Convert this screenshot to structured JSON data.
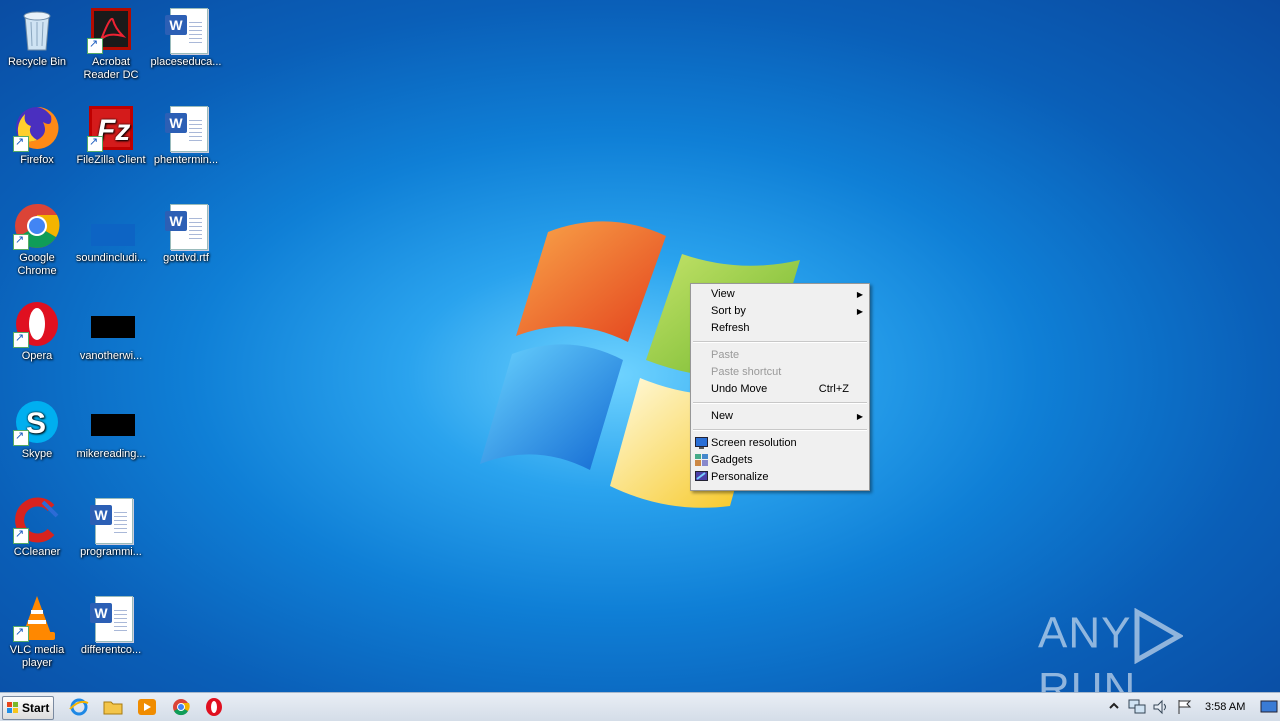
{
  "desktop": {
    "icons": [
      {
        "label": "Recycle Bin",
        "icon": "recycle-bin-icon"
      },
      {
        "label": "Acrobat Reader DC",
        "icon": "acrobat-icon"
      },
      {
        "label": "placeseduca...",
        "icon": "word-document-icon"
      },
      {
        "label": "Firefox",
        "icon": "firefox-icon"
      },
      {
        "label": "FileZilla Client",
        "icon": "filezilla-icon"
      },
      {
        "label": "phentermin...",
        "icon": "word-document-icon"
      },
      {
        "label": "Google Chrome",
        "icon": "chrome-icon"
      },
      {
        "label": "soundincludi...",
        "icon": "blank-file-icon"
      },
      {
        "label": "gotdvd.rtf",
        "icon": "word-document-icon"
      },
      {
        "label": "Opera",
        "icon": "opera-icon"
      },
      {
        "label": "vanotherwi...",
        "icon": "black-file-icon"
      },
      {
        "label": "Skype",
        "icon": "skype-icon"
      },
      {
        "label": "mikereading...",
        "icon": "black-file-icon"
      },
      {
        "label": "CCleaner",
        "icon": "ccleaner-icon"
      },
      {
        "label": "programmi...",
        "icon": "word-document-icon"
      },
      {
        "label": "VLC media player",
        "icon": "vlc-icon"
      },
      {
        "label": "differentco...",
        "icon": "word-document-icon"
      }
    ]
  },
  "context_menu": {
    "view": "View",
    "sort_by": "Sort by",
    "refresh": "Refresh",
    "paste": "Paste",
    "paste_shortcut": "Paste shortcut",
    "undo_move": "Undo Move",
    "undo_shortcut": "Ctrl+Z",
    "new": "New",
    "screen_resolution": "Screen resolution",
    "gadgets": "Gadgets",
    "personalize": "Personalize"
  },
  "taskbar": {
    "start_label": "Start",
    "pinned": [
      "internet-explorer-icon",
      "file-explorer-icon",
      "media-player-icon",
      "chrome-icon",
      "opera-icon"
    ],
    "clock": "3:58 AM"
  },
  "watermark": {
    "text_left": "ANY",
    "text_right": "RUN"
  },
  "colors": {
    "desktop": "#0f7fd6",
    "menu_bg": "#f0f0f0",
    "disabled_text": "#9a9a9a"
  }
}
